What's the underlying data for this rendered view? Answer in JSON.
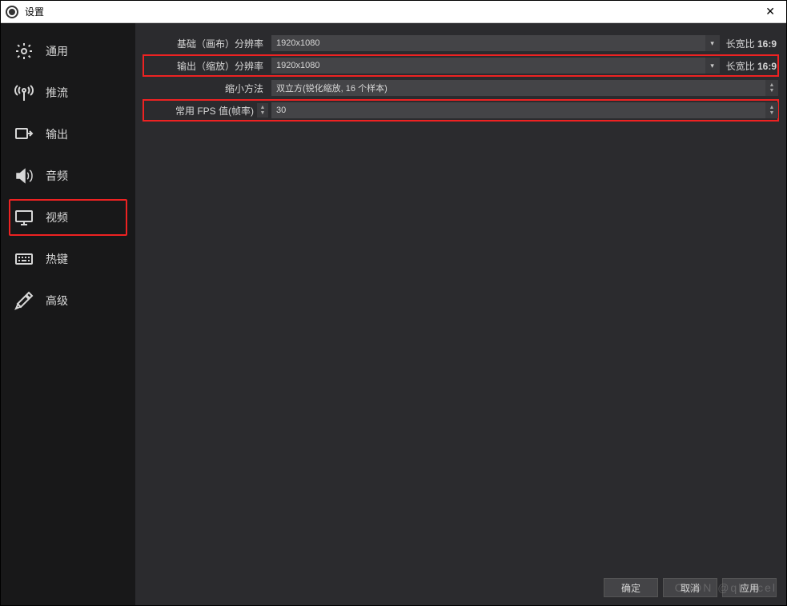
{
  "window": {
    "title": "设置"
  },
  "sidebar": {
    "items": [
      {
        "label": "通用",
        "icon": "gear-icon"
      },
      {
        "label": "推流",
        "icon": "antenna-icon"
      },
      {
        "label": "输出",
        "icon": "output-icon"
      },
      {
        "label": "音频",
        "icon": "speaker-icon"
      },
      {
        "label": "视频",
        "icon": "monitor-icon",
        "active": true
      },
      {
        "label": "热键",
        "icon": "keyboard-icon"
      },
      {
        "label": "高级",
        "icon": "tools-icon"
      }
    ]
  },
  "video": {
    "base_resolution_label": "基础（画布）分辨率",
    "base_resolution_value": "1920x1080",
    "base_aspect_label": "长宽比",
    "base_aspect_value": "16:9",
    "output_resolution_label": "输出（缩放）分辨率",
    "output_resolution_value": "1920x1080",
    "output_aspect_label": "长宽比",
    "output_aspect_value": "16:9",
    "downscale_label": "缩小方法",
    "downscale_value": "双立方(锐化缩放, 16 个样本)",
    "fps_label": "常用 FPS 值(帧率)",
    "fps_value": "30"
  },
  "footer": {
    "ok": "确定",
    "cancel": "取消",
    "apply": "应用"
  },
  "watermark": "CSDN @qlexcel"
}
